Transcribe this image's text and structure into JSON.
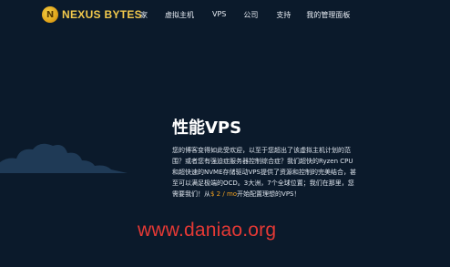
{
  "brand": {
    "name": "NEXUS BYTES",
    "logo_glyph": "N",
    "accent": "#f2c94c"
  },
  "nav": {
    "items": [
      {
        "label": "家"
      },
      {
        "label": "虚拟主机"
      },
      {
        "label": "VPS"
      },
      {
        "label": "公司"
      },
      {
        "label": "支持"
      },
      {
        "label": "我的管理面板"
      }
    ]
  },
  "hero": {
    "title": "性能VPS",
    "desc_before": "您的博客变得如此受欢迎，以至于您超出了该虚拟主机计划的范围？或者您有强迫症服务器控制综合症？我们超快的Ryzen CPU和超快速的NVME存储驱动VPS提供了资源和控制的完美结合，甚至可以满足极端的OCD。3大洲，7个全球位置；我们在那里，您需要我们！从",
    "price": "$ 2 / mo",
    "desc_after": "开始配置理想的VPS！",
    "price_color": "#f0a020"
  },
  "watermark": {
    "text": "www.daniao.org",
    "color": "#e53935"
  },
  "colors": {
    "background": "#0b1a2b",
    "cloud": "#1f3a56"
  }
}
